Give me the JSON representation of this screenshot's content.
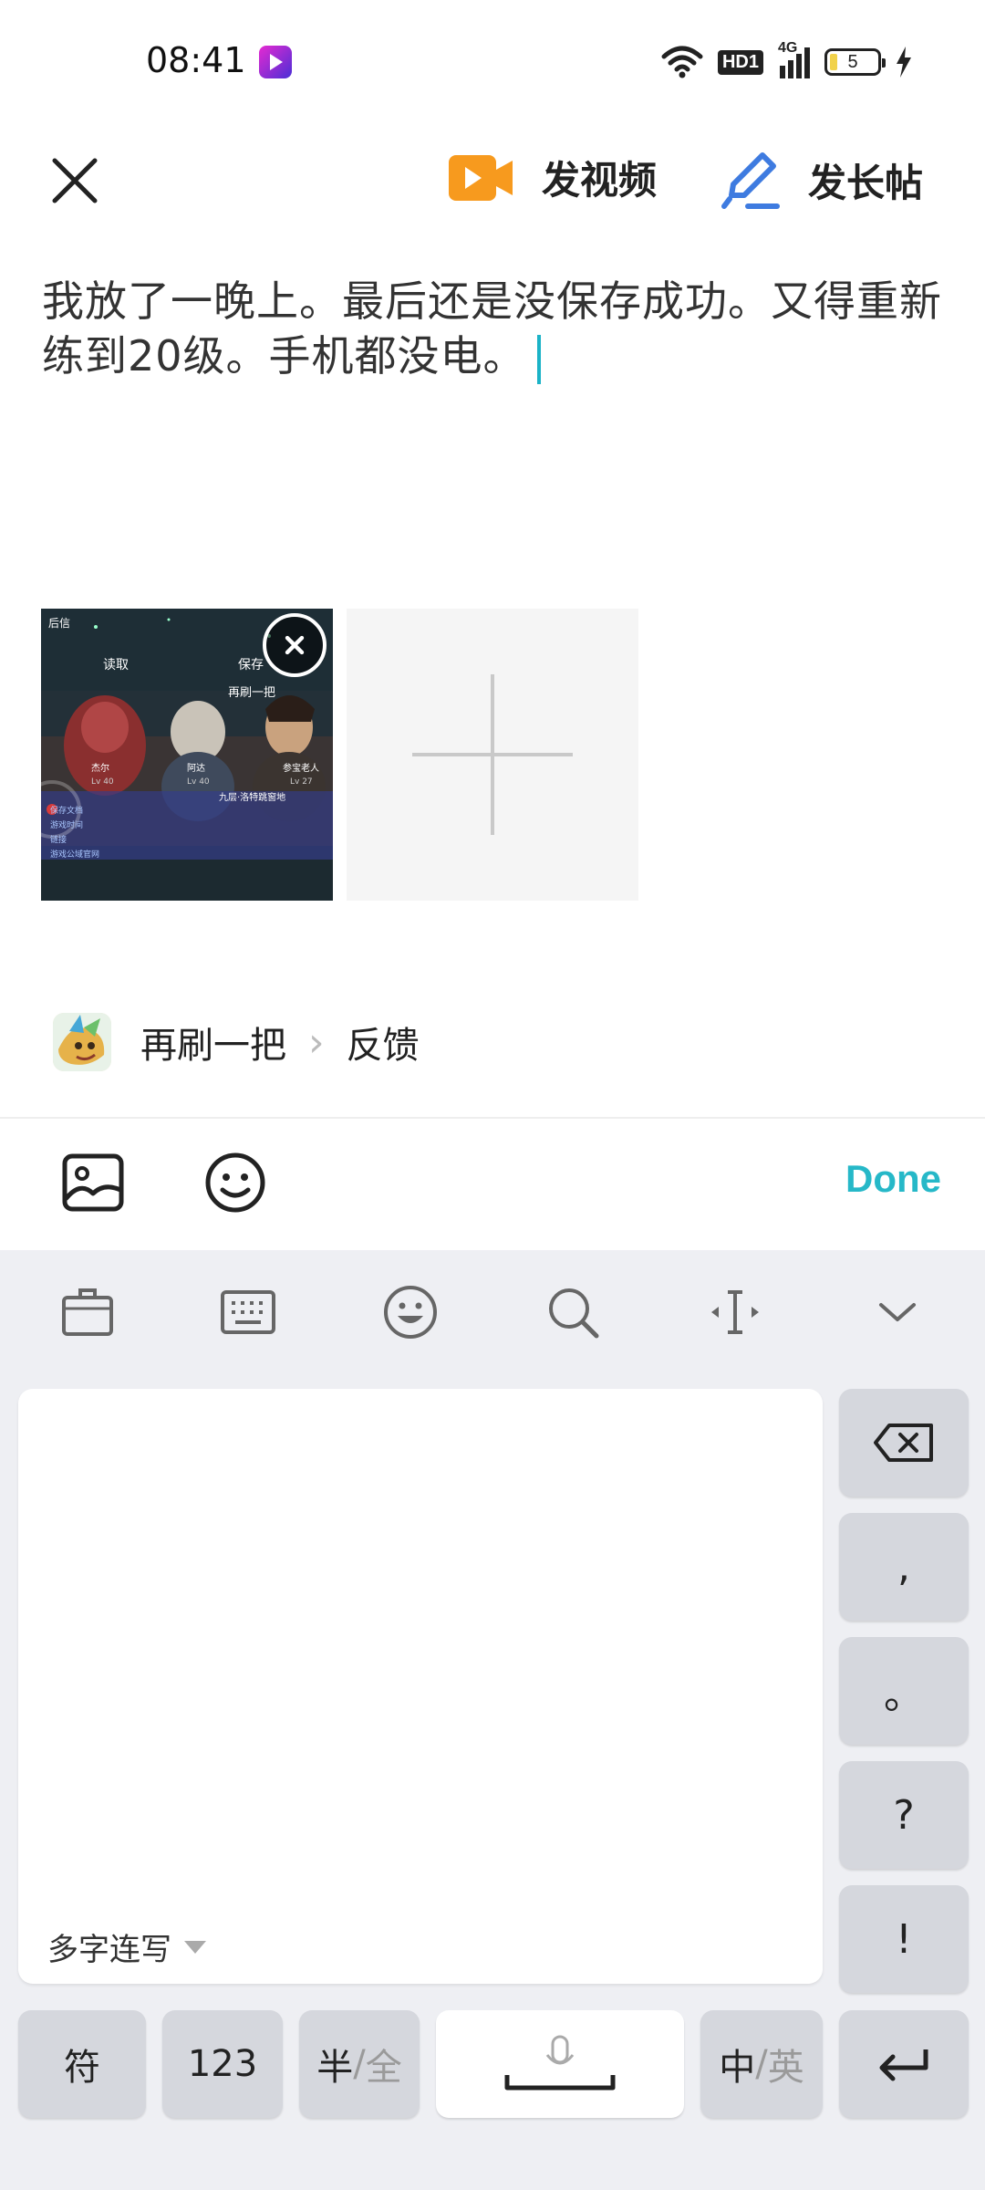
{
  "status_bar": {
    "time": "08:41",
    "network_badge": "HD1",
    "signal_label": "4G",
    "battery_level": "5",
    "icons": [
      "app-notification-icon",
      "wifi-icon",
      "hd-icon",
      "cellular-signal-icon",
      "battery-icon",
      "charging-bolt-icon"
    ]
  },
  "topbar": {
    "video_label": "发视频",
    "long_post_label": "发长帖",
    "video_icon_color": "#f79a1e",
    "pen_icon_color": "#3e7be0"
  },
  "editor": {
    "text": "我放了一晚上。最后还是没保存成功。又得重新练到20级。手机都没电。"
  },
  "attachment": {
    "thumbnail_texts": {
      "load": "读取",
      "save": "保存",
      "retry": "再刷一把",
      "char1": "杰尔",
      "char1_level": "Lv 40",
      "char2": "阿达",
      "char2_level": "Lv 40",
      "char3": "参宝老人",
      "char3_level": "Lv 27",
      "floor_info": "九层·洛特跳窗地",
      "menu1": "保存文档",
      "menu2": "游戏时间",
      "menu3": "链接",
      "menu4": "游戏公域官网",
      "corner": "后信"
    }
  },
  "community": {
    "name": "再刷一把",
    "separator": "›",
    "category": "反馈"
  },
  "editor_toolbar": {
    "done_label": "Done",
    "accent_color": "#26b8c8"
  },
  "keyboard": {
    "mode_label": "多字连写",
    "side_keys": [
      ",",
      "。",
      "?",
      "!"
    ],
    "keys": {
      "symbols": "符",
      "numbers": "123",
      "half_width": "半",
      "full_width": "全",
      "width_separator": "/",
      "chinese": "中",
      "english": "英",
      "lang_separator": "/"
    }
  }
}
